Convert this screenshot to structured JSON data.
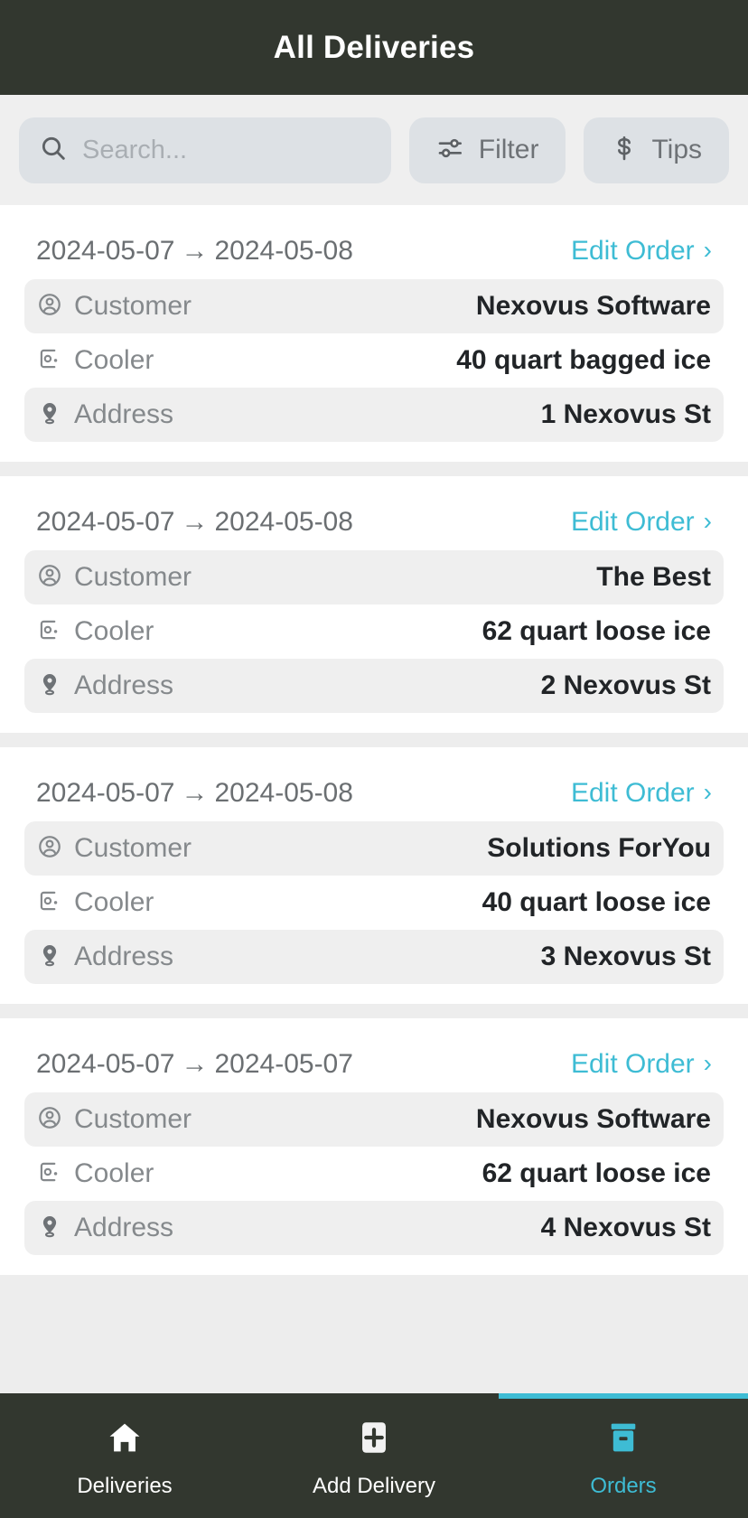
{
  "header": {
    "title": "All Deliveries"
  },
  "toolbar": {
    "search": {
      "placeholder": "Search...",
      "value": "",
      "icon": "search-icon"
    },
    "filter": {
      "label": "Filter",
      "icon": "sliders-icon"
    },
    "tips": {
      "label": "Tips",
      "icon": "dollar-icon"
    }
  },
  "row_labels": {
    "customer": "Customer",
    "cooler": "Cooler",
    "address": "Address"
  },
  "icons": {
    "customer": "user-circle-icon",
    "cooler": "cooler-box-icon",
    "address": "map-pin-icon",
    "edit_chevron": "chevron-right-icon",
    "date_arrow": "arrow-right-icon"
  },
  "colors": {
    "header_bg": "#32372f",
    "accent": "#3ebcd4",
    "toolbar_bg": "#efefef",
    "pill_bg": "#dde1e5",
    "row_alt_bg": "#efefef",
    "value_text": "#212427",
    "label_text": "#85898c"
  },
  "edit_order_label": "Edit Order",
  "date_arrow_glyph": "→",
  "chevron_glyph": "›",
  "deliveries": [
    {
      "date_start": "2024-05-07",
      "date_end": "2024-05-08",
      "customer": "Nexovus Software",
      "cooler": "40 quart bagged ice",
      "address": "1 Nexovus St"
    },
    {
      "date_start": "2024-05-07",
      "date_end": "2024-05-08",
      "customer": "The Best",
      "cooler": "62 quart loose ice",
      "address": "2 Nexovus St"
    },
    {
      "date_start": "2024-05-07",
      "date_end": "2024-05-08",
      "customer": "Solutions ForYou",
      "cooler": "40 quart loose ice",
      "address": "3 Nexovus St"
    },
    {
      "date_start": "2024-05-07",
      "date_end": "2024-05-07",
      "customer": "Nexovus Software",
      "cooler": "62 quart loose ice",
      "address": "4 Nexovus St"
    }
  ],
  "bottom_nav": {
    "items": [
      {
        "label": "Deliveries",
        "icon": "home-icon",
        "active": false
      },
      {
        "label": "Add Delivery",
        "icon": "plus-square-icon",
        "active": false
      },
      {
        "label": "Orders",
        "icon": "cooler-icon",
        "active": true
      }
    ]
  }
}
